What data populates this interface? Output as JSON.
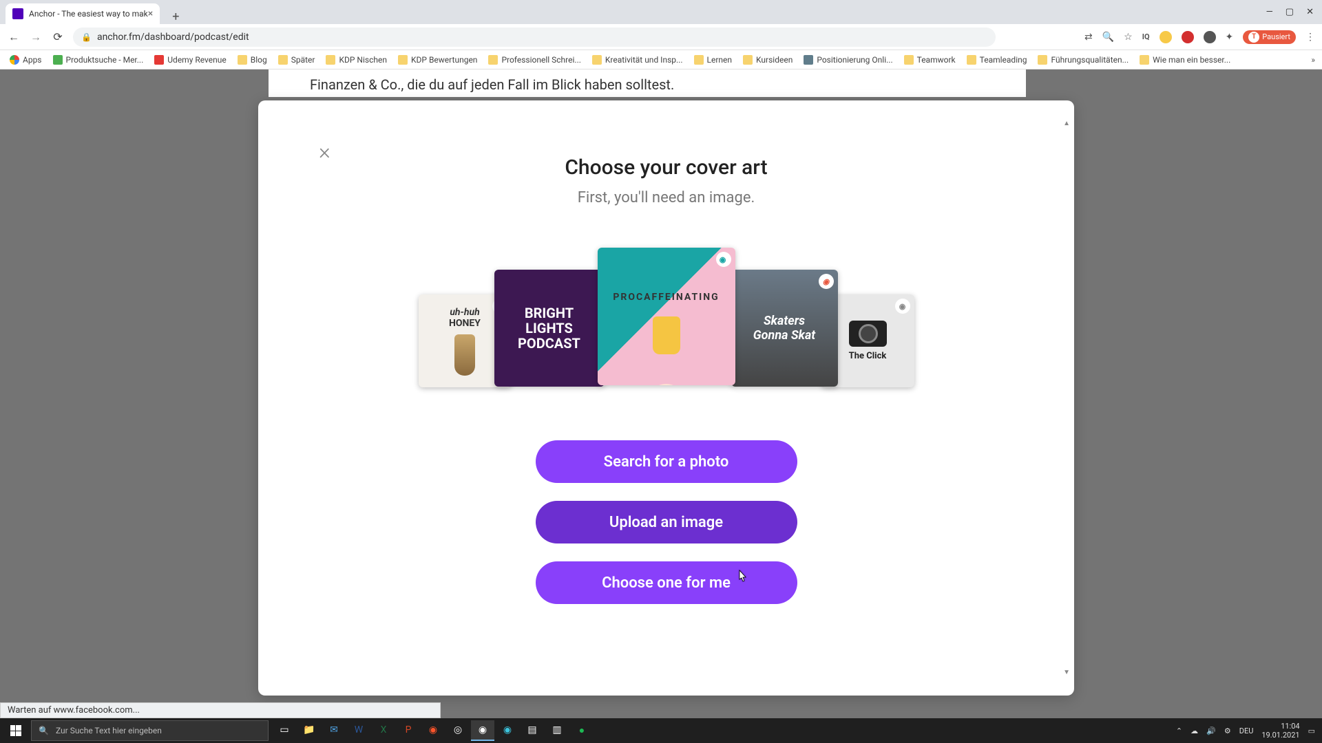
{
  "browser": {
    "tab_title": "Anchor - The easiest way to mak",
    "url": "anchor.fm/dashboard/podcast/edit",
    "profile_label": "Pausiert",
    "window_controls": {
      "min": "—",
      "max": "▢",
      "close": "✕"
    }
  },
  "bookmarks": [
    "Apps",
    "Produktsuche - Mer...",
    "Udemy Revenue",
    "Blog",
    "Später",
    "KDP Nischen",
    "KDP Bewertungen",
    "Professionell Schrei...",
    "Kreativität und Insp...",
    "Lernen",
    "Kursideen",
    "Positionierung Onli...",
    "Teamwork",
    "Teamleading",
    "Führungsqualitäten...",
    "Wie man ein besser..."
  ],
  "page_behind": "Finanzen & Co., die du auf jeden Fall im Blick haben solltest.",
  "modal": {
    "title": "Choose your cover art",
    "subtitle": "First, you'll need an image.",
    "covers": {
      "c1_line1": "uh-huh",
      "c1_line2": "HONEY",
      "c2_line1": "BRIGHT",
      "c2_line2": "LIGHTS",
      "c2_line3": "PODCAST",
      "c3_title": "PROCAFFEINATING",
      "c4_line1": "Skaters",
      "c4_line2": "Gonna Skat",
      "c5_title": "The Click"
    },
    "buttons": {
      "search": "Search for a photo",
      "upload": "Upload an image",
      "choose": "Choose one for me"
    }
  },
  "status_message": "Warten auf www.facebook.com...",
  "taskbar": {
    "search_placeholder": "Zur Suche Text hier eingeben",
    "lang": "DEU",
    "time": "11:04",
    "date": "19.01.2021"
  }
}
